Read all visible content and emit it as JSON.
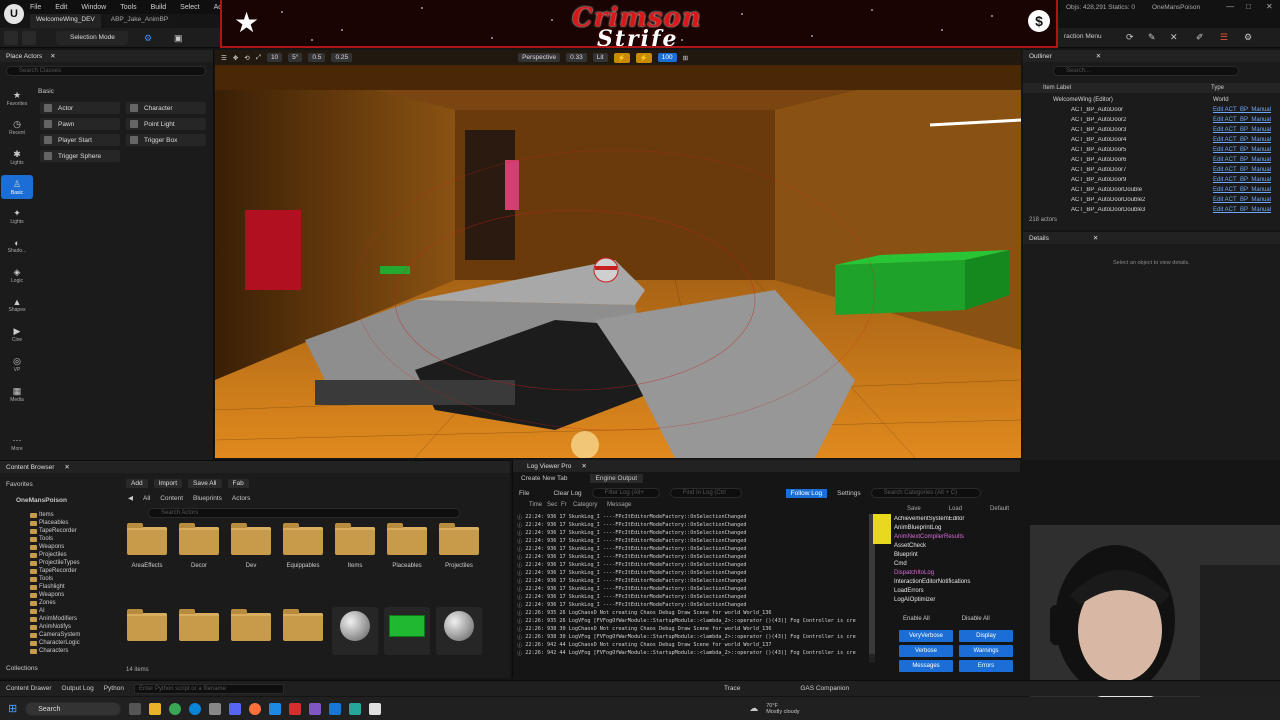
{
  "menubar": {
    "items": [
      "File",
      "Edit",
      "Window",
      "Tools",
      "Build",
      "Select",
      "Actor"
    ]
  },
  "tabs": [
    {
      "label": "WelcomeWing_DEV"
    },
    {
      "label": "ABP_Jake_AnimBP"
    }
  ],
  "toolbar": {
    "selection_mode": "Selection Mode",
    "interaction_menu": "raction Menu"
  },
  "banner": {
    "title": "Crimson",
    "subtitle": "Strife"
  },
  "topright": {
    "stats": "Objs: 428,291  Statics: 0",
    "project": "OneMansPoison"
  },
  "place_actors": {
    "title": "Place Actors",
    "search_placeholder": "Search Classes",
    "section": "Basic",
    "categories": [
      "Favorites",
      "Recent",
      "Lights",
      "Basic",
      "Lights",
      "Shado...",
      "Logic",
      "Shapes",
      "Cine",
      "VP",
      "Media",
      "More"
    ],
    "actors": [
      "Actor",
      "Character",
      "Pawn",
      "Point Light",
      "Player Start",
      "Trigger Box",
      "Trigger Sphere"
    ]
  },
  "viewport": {
    "perspective": "Perspective",
    "lit": "Lit",
    "speed": "0.33",
    "camera_speed": "100",
    "chips": [
      "10",
      "5°",
      "0.5",
      "0.25"
    ]
  },
  "outliner": {
    "title": "Outliner",
    "search_placeholder": "Search...",
    "col_label": "Item Label",
    "col_type": "Type",
    "root": "WelcomeWing (Editor)",
    "root_type": "World",
    "rows": [
      "ACT_BP_AutoDoor",
      "ACT_BP_AutoDoor2",
      "ACT_BP_AutoDoor3",
      "ACT_BP_AutoDoor4",
      "ACT_BP_AutoDoor5",
      "ACT_BP_AutoDoor6",
      "ACT_BP_AutoDoor7",
      "ACT_BP_AutoDoor9",
      "ACT_BP_AutoDoorDouble",
      "ACT_BP_AutoDoorDouble2",
      "ACT_BP_AutoDoorDouble3"
    ],
    "row_type": "Edit ACT_BP_Manual",
    "count": "218 actors"
  },
  "details": {
    "title": "Details",
    "empty": "Select an object to view details."
  },
  "content_browser": {
    "title": "Content Browser",
    "add": "Add",
    "import": "Import",
    "save_all": "Save All",
    "fab": "Fab",
    "breadcrumb": [
      "All",
      "Content",
      "Blueprints",
      "Actors"
    ],
    "search_placeholder": "Search Actors",
    "favorites": "Favorites",
    "project": "OneMansPoison",
    "tree": [
      "Items",
      "Placeables",
      "TapeRecorder",
      "Tools",
      "Weapons",
      "Projectiles",
      "ProjectileTypes",
      "TapeRecorder",
      "Tools",
      "Flashlight",
      "Weapons",
      "Zones",
      "AI",
      "AnimModifiers",
      "AnimNotifys",
      "CameraSystem",
      "CharacterLogic",
      "Characters"
    ],
    "folders": [
      "AreaEffects",
      "Decor",
      "Dev",
      "Equippables",
      "Items",
      "Placeables",
      "Projectiles"
    ],
    "item_count": "14 items",
    "collections": "Collections"
  },
  "log": {
    "tab_title": "Log Viewer Pro",
    "create_tab": "Create New Tab",
    "engine_output": "Engine Output",
    "file": "File",
    "clear": "Clear Log",
    "filter_placeholder": "Filter Log (Alt+",
    "find_placeholder": "Find In Log (Ctrl",
    "follow": "Follow Log",
    "settings": "Settings",
    "cat_search_placeholder": "Search Categories (Alt + C)",
    "cols": [
      "Time",
      "Sec",
      "Fr",
      "Category",
      "Message"
    ],
    "lines": [
      [
        "22:24:",
        "936",
        "17",
        "SkunkLog_I",
        "----FPcItEditorModeFactory::OnSelectionChanged"
      ],
      [
        "22:24:",
        "936",
        "17",
        "SkunkLog_I",
        "----FPcItEditorModeFactory::OnSelectionChanged"
      ],
      [
        "22:24:",
        "936",
        "17",
        "SkunkLog_I",
        "----FPcItEditorModeFactory::OnSelectionChanged"
      ],
      [
        "22:24:",
        "936",
        "17",
        "SkunkLog_I",
        "----FPcItEditorModeFactory::OnSelectionChanged"
      ],
      [
        "22:24:",
        "936",
        "17",
        "SkunkLog_I",
        "----FPcItEditorModeFactory::OnSelectionChanged"
      ],
      [
        "22:24:",
        "936",
        "17",
        "SkunkLog_I",
        "----FPcItEditorModeFactory::OnSelectionChanged"
      ],
      [
        "22:24:",
        "936",
        "17",
        "SkunkLog_I",
        "----FPcItEditorModeFactory::OnSelectionChanged"
      ],
      [
        "22:24:",
        "936",
        "17",
        "SkunkLog_I",
        "----FPcItEditorModeFactory::OnSelectionChanged"
      ],
      [
        "22:24:",
        "936",
        "17",
        "SkunkLog_I",
        "----FPcItEditorModeFactory::OnSelectionChanged"
      ],
      [
        "22:24:",
        "936",
        "17",
        "SkunkLog_I",
        "----FPcItEditorModeFactory::OnSelectionChanged"
      ],
      [
        "22:24:",
        "936",
        "17",
        "SkunkLog_I",
        "----FPcItEditorModeFactory::OnSelectionChanged"
      ],
      [
        "22:24:",
        "936",
        "17",
        "SkunkLog_I",
        "----FPcItEditorModeFactory::OnSelectionChanged"
      ],
      [
        "22:26:",
        "935",
        "26",
        "LogChaosD",
        "Not creating Chaos Debug Draw Scene for world World_136"
      ],
      [
        "22:26:",
        "935",
        "26",
        "LogVFog",
        "[FVFogOfWarModule::StartupModule::<lambda_2>::operator ()(43)] Fog Controller is cre"
      ],
      [
        "22:26:",
        "938",
        "30",
        "LogChaosD",
        "Not creating Chaos Debug Draw Scene for world World_136"
      ],
      [
        "22:26:",
        "938",
        "30",
        "LogVFog",
        "[FVFogOfWarModule::StartupModule::<lambda_2>::operator ()(43)] Fog Controller is cre"
      ],
      [
        "22:26:",
        "942",
        "44",
        "LogChaosD",
        "Not creating Chaos Debug Draw Scene for world World_137"
      ],
      [
        "22:26:",
        "942",
        "44",
        "LogVFog",
        "[FVFogOfWarModule::StartupModule::<lambda_2>::operator ()(43)] Fog Controller is cre"
      ]
    ],
    "cat_header": [
      "Save",
      "Load",
      "Default"
    ],
    "categories": [
      "AchievementSystemEditor",
      "AnimBlueprintLog",
      "AnimNextCompilerResults",
      "AssetCheck",
      "Blueprint",
      "Cmd",
      "DispatchItoLog",
      "InteractionEditorNotifications",
      "LoadErrors",
      "LogAIOptimizer"
    ],
    "enable_all": "Enable All",
    "disable_all": "Disable All",
    "levels": [
      "VeryVerbose",
      "Display",
      "Verbose",
      "Warnings",
      "Messages",
      "Errors"
    ]
  },
  "statusbar": {
    "content_drawer": "Content Drawer",
    "output_log": "Output Log",
    "python": "Python",
    "python_placeholder": "Enter Python script or a filename",
    "trace": "Trace",
    "companion": "GAS Companion",
    "perf": "Performan"
  },
  "taskbar": {
    "search": "Search",
    "weather": "70°F",
    "weather_desc": "Mostly cloudy"
  }
}
